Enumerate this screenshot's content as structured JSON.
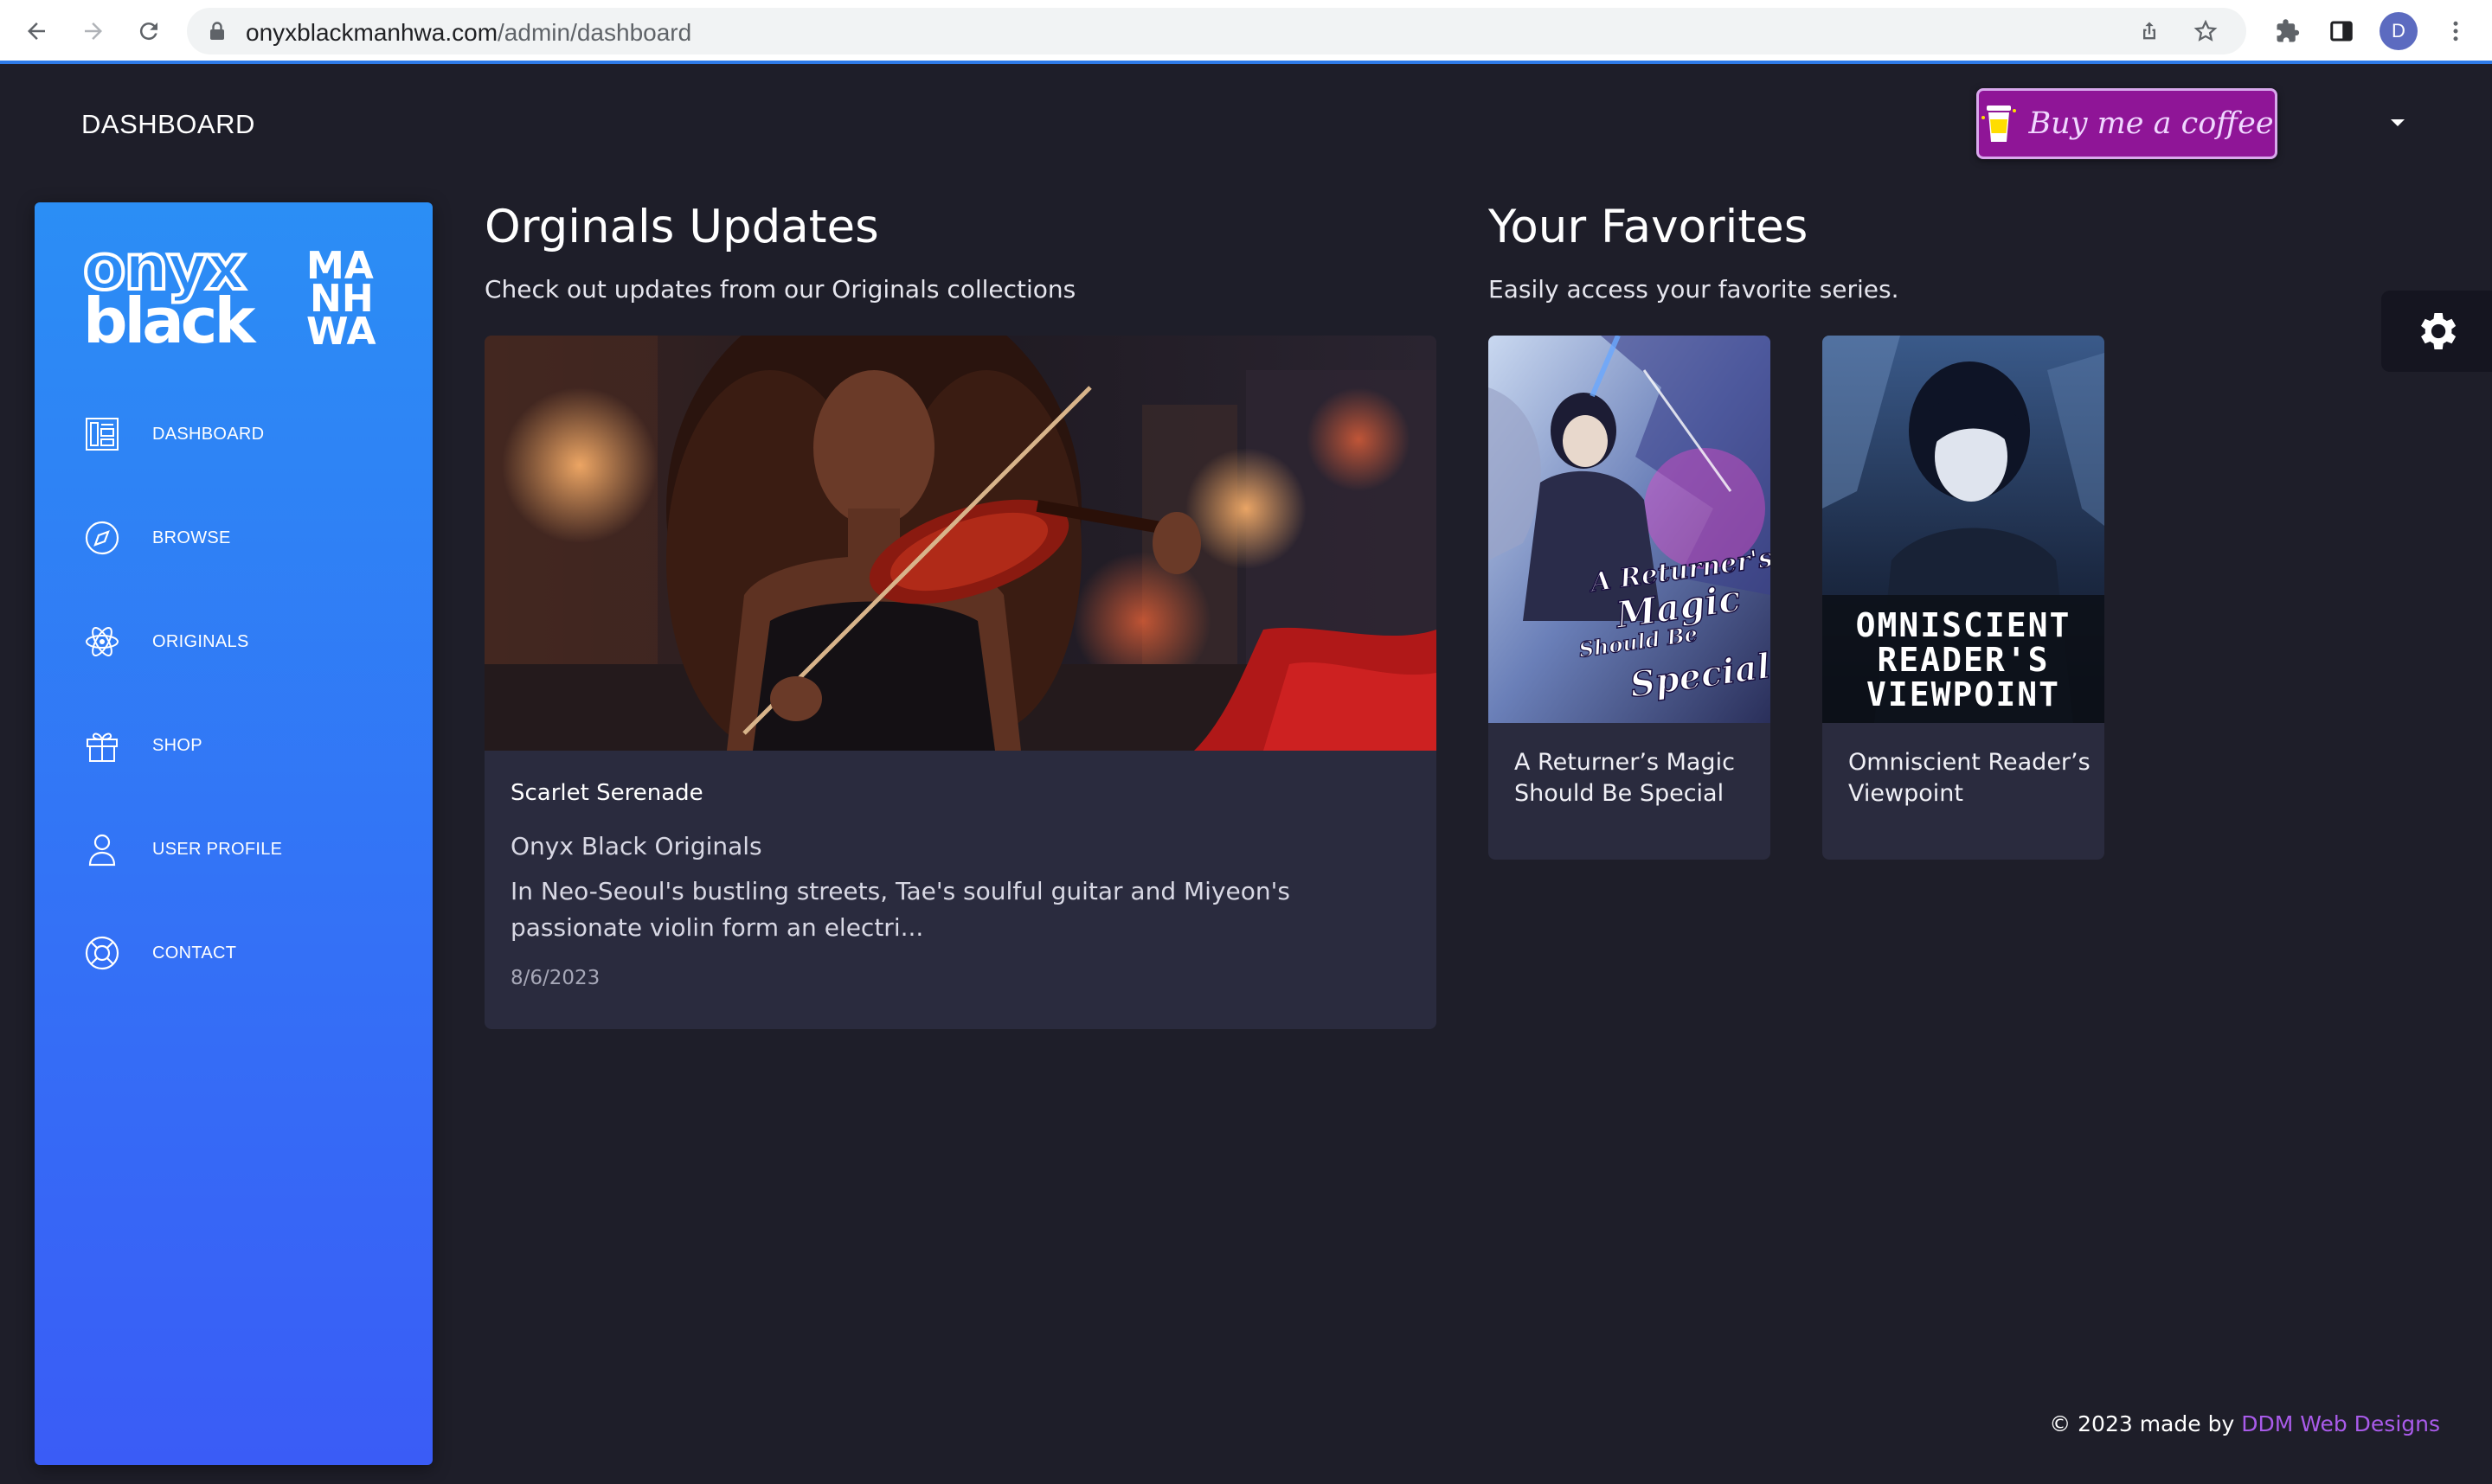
{
  "browser": {
    "url_domain": "onyxblackmanhwa.com",
    "url_path": "/admin/dashboard",
    "profile_initial": "D"
  },
  "header": {
    "title": "DASHBOARD",
    "coffee_label": "Buy me a coffee"
  },
  "sidebar": {
    "logo_text_main": "onyx black",
    "logo_text_side": "MA NH WA",
    "items": [
      {
        "label": "DASHBOARD",
        "icon": "dashboard-icon"
      },
      {
        "label": "BROWSE",
        "icon": "compass-icon"
      },
      {
        "label": "ORIGINALS",
        "icon": "atom-icon"
      },
      {
        "label": "SHOP",
        "icon": "gift-icon"
      },
      {
        "label": "USER PROFILE",
        "icon": "user-icon"
      },
      {
        "label": "CONTACT",
        "icon": "lifebuoy-icon"
      }
    ]
  },
  "originals": {
    "title": "Orginals Updates",
    "subtitle": "Check out updates from our Originals collections",
    "card": {
      "series": "Scarlet Serenade",
      "collection": "Onyx Black Originals",
      "description": "In Neo-Seoul's bustling streets, Tae's soulful guitar and Miyeon's passionate violin form an electri...",
      "date": "8/6/2023"
    }
  },
  "favorites": {
    "title": "Your Favorites",
    "subtitle": "Easily access your favorite series.",
    "items": [
      {
        "title": "A Returner’s Magic Should Be Special",
        "cover_text": [
          "A Returner's",
          "Magic",
          "Should Be",
          "Special"
        ]
      },
      {
        "title": "Omniscient Reader’s Viewpoint",
        "cover_text": [
          "OMNISCIENT",
          "READER'S",
          "VIEWPOINT"
        ]
      }
    ]
  },
  "footer": {
    "prefix": "© 2023 made by ",
    "link": "DDM Web Designs"
  },
  "colors": {
    "background": "#1e1e29",
    "card": "#2a2b3e",
    "sidebar_top": "#2b8ef5",
    "sidebar_bottom": "#3a5cf6",
    "coffee_button": "#8f1597",
    "footer_link": "#a95bea"
  }
}
